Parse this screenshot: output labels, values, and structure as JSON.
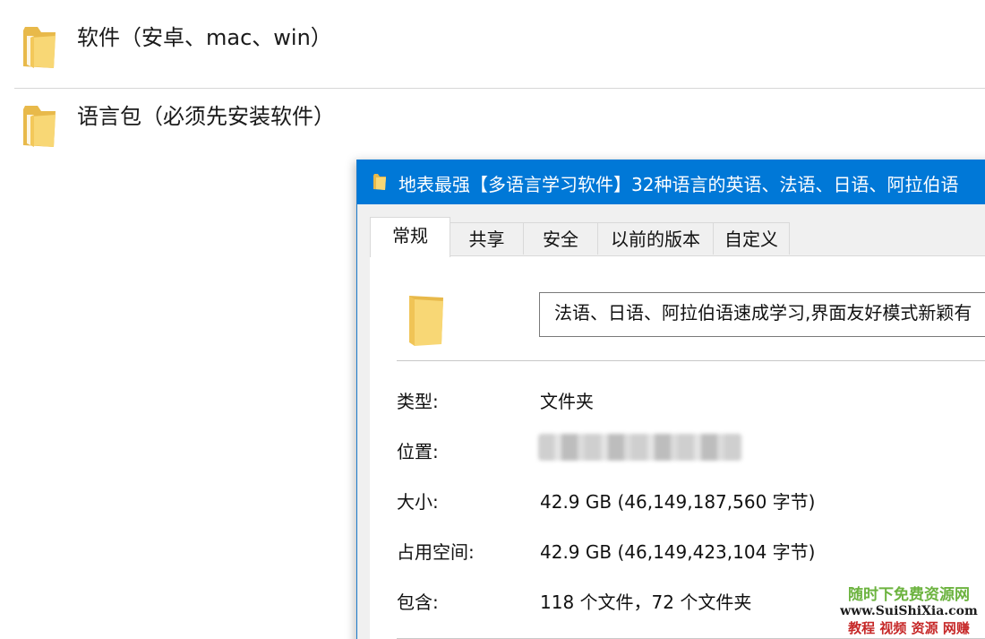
{
  "explorer": {
    "items": [
      {
        "label": "软件（安卓、mac、win）",
        "icon": "folder-icon"
      },
      {
        "label": "语言包（必须先安装软件）",
        "icon": "folder-icon"
      }
    ]
  },
  "dialog": {
    "title": "地表最强【多语言学习软件】32种语言的英语、法语、日语、阿拉伯语",
    "tabs": [
      {
        "label": "常规",
        "active": true
      },
      {
        "label": "共享",
        "active": false
      },
      {
        "label": "安全",
        "active": false
      },
      {
        "label": "以前的版本",
        "active": false
      },
      {
        "label": "自定义",
        "active": false
      }
    ],
    "name_field": "法语、日语、阿拉伯语速成学习,界面友好模式新颖有",
    "properties": [
      {
        "label": "类型:",
        "value": "文件夹"
      },
      {
        "label": "位置:",
        "value": ""
      },
      {
        "label": "大小:",
        "value": "42.9 GB (46,149,187,560 字节)"
      },
      {
        "label": "占用空间:",
        "value": "42.9 GB (46,149,423,104 字节)"
      },
      {
        "label": "包含:",
        "value": "118 个文件，72 个文件夹"
      }
    ]
  },
  "watermark": {
    "line1": "随时下免费资源网",
    "line2": "www.SuiShiXia.com",
    "line3": "教程 视频 资源 网赚"
  },
  "colors": {
    "title_bar": "#0078d7",
    "folder_yellow": "#f8d775"
  }
}
